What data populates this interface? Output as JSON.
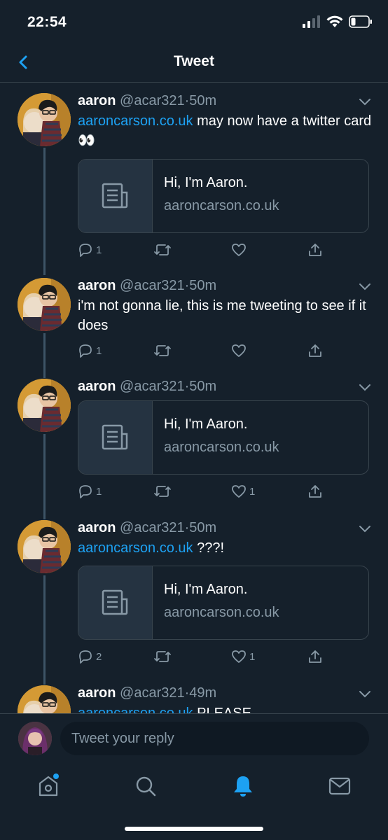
{
  "status_bar": {
    "time": "22:54"
  },
  "nav": {
    "title": "Tweet"
  },
  "tweets": [
    {
      "name": "aaron",
      "handle": "@acar321",
      "sep": "·",
      "time": "50m",
      "link": "aaroncarson.co.uk",
      "text": " may now have a twitter card 👀",
      "card": {
        "title": "Hi, I'm Aaron.",
        "domain": "aaroncarson.co.uk"
      },
      "replies": "1",
      "retweets": "",
      "likes": ""
    },
    {
      "name": "aaron",
      "handle": "@acar321",
      "sep": "·",
      "time": "50m",
      "text": "i'm not gonna lie, this is me tweeting to see if it does",
      "replies": "1",
      "retweets": "",
      "likes": ""
    },
    {
      "name": "aaron",
      "handle": "@acar321",
      "sep": "·",
      "time": "50m",
      "card": {
        "title": "Hi, I'm Aaron.",
        "domain": "aaroncarson.co.uk"
      },
      "replies": "1",
      "retweets": "",
      "likes": "1"
    },
    {
      "name": "aaron",
      "handle": "@acar321",
      "sep": "·",
      "time": "50m",
      "link": "aaroncarson.co.uk",
      "text": " ???!",
      "card": {
        "title": "Hi, I'm Aaron.",
        "domain": "aaroncarson.co.uk"
      },
      "replies": "2",
      "retweets": "",
      "likes": "1"
    },
    {
      "name": "aaron",
      "handle": "@acar321",
      "sep": "·",
      "time": "49m",
      "link": "aaroncarson.co.uk",
      "text": " PLEASE"
    }
  ],
  "reply": {
    "placeholder": "Tweet your reply"
  },
  "tabs": [
    {
      "icon": "home-icon",
      "has_notification_dot": true
    },
    {
      "icon": "search-icon"
    },
    {
      "icon": "bell-icon",
      "active": true
    },
    {
      "icon": "mail-icon"
    }
  ],
  "colors": {
    "background": "#15202b",
    "accent": "#1da1f2",
    "secondary_text": "#8899a6",
    "divider": "#38444d"
  }
}
